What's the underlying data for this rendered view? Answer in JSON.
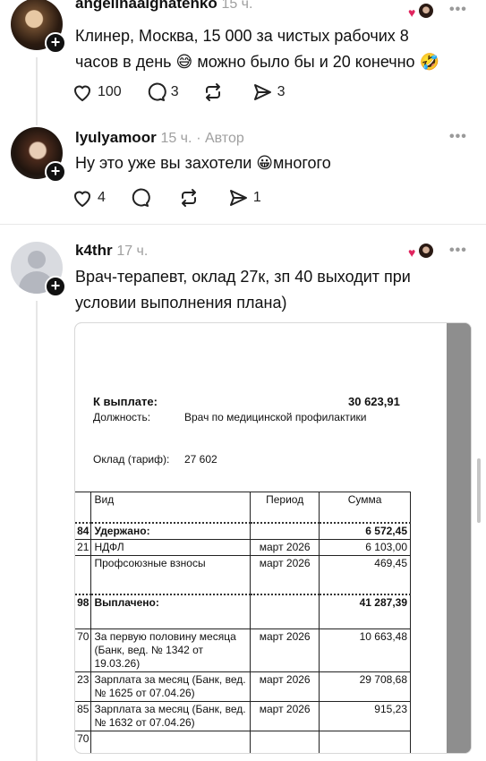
{
  "posts": [
    {
      "username": "angelinaaignatenko",
      "time": "15 ч.",
      "text_line1": "Клинер, Москва, 15 000 за чистых рабочих 8",
      "text_line2": "часов в день 😅 можно было бы и 20 конечно 🤣",
      "likes": "100",
      "replies": "3",
      "reposts": "",
      "shares": "3"
    },
    {
      "username": "lyulyamoor",
      "time": "15 ч.",
      "badge": "· Автор",
      "text": "Ну это уже вы захотели 😀многого",
      "likes": "4",
      "replies": "",
      "reposts": "",
      "shares": "1"
    },
    {
      "username": "k4thr",
      "time": "17 ч.",
      "text_line1": "Врач-терапевт, оклад 27к, зп 40 выходит при",
      "text_line2": "условии выполнения плана)"
    }
  ],
  "more_icon": "•••",
  "document": {
    "k_vyplate_label": "К выплате:",
    "k_vyplate_value": "30 623,91",
    "position_label": "Должность:",
    "position_value": "Врач по медицинской профилактики",
    "salary_label": "Оклад (тариф):",
    "salary_value": "27 602",
    "table": {
      "col_type": "Вид",
      "col_period": "Период",
      "col_sum": "Сумма",
      "rows": [
        {
          "num": "84",
          "name": "Удержано:",
          "period": "",
          "sum": "6 572,45",
          "section": true
        },
        {
          "num": "21",
          "name": "НДФЛ",
          "period": "март 2026",
          "sum": "6 103,00"
        },
        {
          "num": "",
          "name": "Профсоюзные взносы",
          "period": "март 2026",
          "sum": "469,45"
        },
        {
          "num": "98",
          "name": "Выплачено:",
          "period": "",
          "sum": "41 287,39",
          "section": true
        },
        {
          "num": "70",
          "name": "За первую половину месяца (Банк, вед. № 1342 от 19.03.26)",
          "period": "март 2026",
          "sum": "10 663,48"
        },
        {
          "num": "23",
          "name": "Зарплата за месяц (Банк, вед. № 1625 от 07.04.26)",
          "period": "март 2026",
          "sum": "29 708,68"
        },
        {
          "num": "85",
          "name": "Зарплата за месяц (Банк, вед. № 1632 от 07.04.26)",
          "period": "март 2026",
          "sum": "915,23"
        },
        {
          "num": "70",
          "name": "",
          "period": "",
          "sum": ""
        }
      ]
    }
  },
  "colors": {
    "heart": "#e0245e",
    "meta": "#a0a0a0"
  }
}
